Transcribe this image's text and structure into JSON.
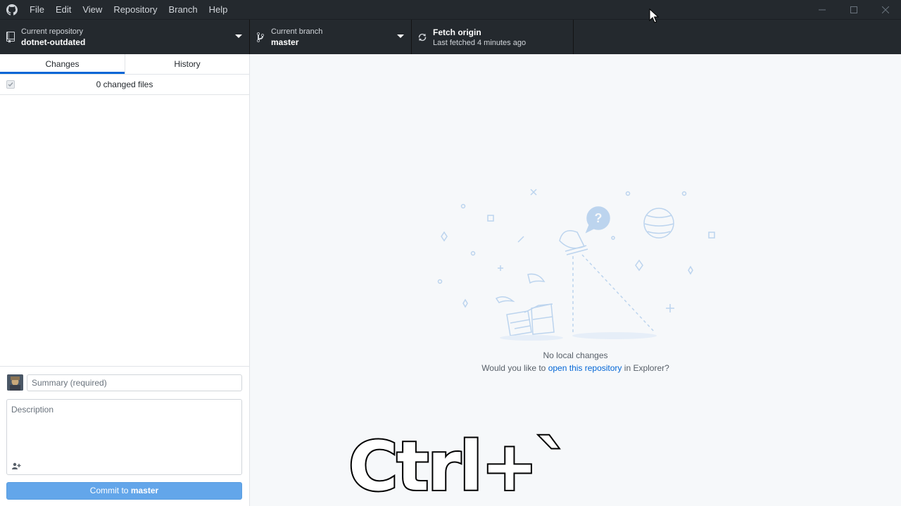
{
  "titlebar": {
    "menu": [
      "File",
      "Edit",
      "View",
      "Repository",
      "Branch",
      "Help"
    ],
    "icons": {
      "logo": "github-octocat-icon",
      "minimize": "minimize-icon",
      "maximize": "maximize-icon",
      "close": "close-icon"
    }
  },
  "toolbar": {
    "repo": {
      "label": "Current repository",
      "value": "dotnet-outdated",
      "icon": "repo-icon"
    },
    "branch": {
      "label": "Current branch",
      "value": "master",
      "icon": "branch-icon"
    },
    "fetch": {
      "label": "Fetch origin",
      "value": "Last fetched 4 minutes ago",
      "icon": "sync-icon"
    }
  },
  "sidebar": {
    "tabs": [
      {
        "label": "Changes",
        "active": true
      },
      {
        "label": "History",
        "active": false
      }
    ],
    "changes_count": "0 changed files",
    "commit": {
      "summary_placeholder": "Summary (required)",
      "description_placeholder": "Description",
      "button_prefix": "Commit to",
      "button_branch": "master"
    }
  },
  "main": {
    "no_changes_title": "No local changes",
    "prompt_before": "Would you like to",
    "prompt_link": "open this repository",
    "prompt_after": "in Explorer?"
  },
  "overlay": {
    "keystroke": "Ctrl+`"
  },
  "colors": {
    "chrome": "#24292e",
    "accent": "#0366d6",
    "commit_button": "#63a6ea",
    "illustration": "#bcd4ee"
  }
}
